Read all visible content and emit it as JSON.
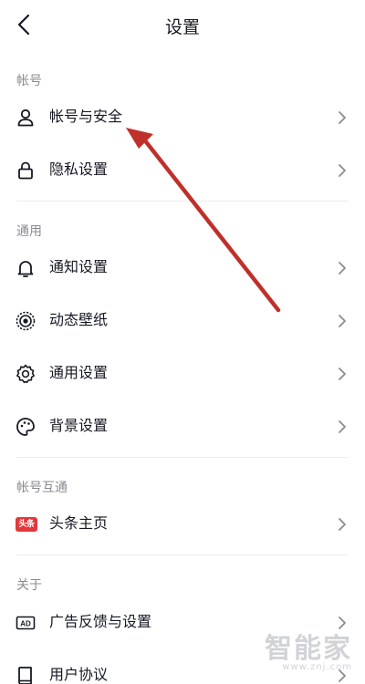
{
  "header": {
    "title": "设置"
  },
  "sections": {
    "account": {
      "label": "帐号"
    },
    "general": {
      "label": "通用"
    },
    "linked": {
      "label": "帐号互通"
    },
    "about": {
      "label": "关于"
    }
  },
  "items": {
    "account_security": "帐号与安全",
    "privacy": "隐私设置",
    "notification": "通知设置",
    "live_wallpaper": "动态壁纸",
    "general_settings": "通用设置",
    "background": "背景设置",
    "toutiao_home": "头条主页",
    "ad_feedback": "广告反馈与设置",
    "user_agreement": "用户协议"
  },
  "badges": {
    "toutiao": "头条",
    "ad": "AD"
  },
  "icons": [
    "back-arrow-icon",
    "user-icon",
    "lock-icon",
    "bell-icon",
    "wallpaper-icon",
    "gear-icon",
    "palette-icon",
    "toutiao-icon",
    "ad-icon",
    "book-icon",
    "chevron-right-icon"
  ],
  "annotation": {
    "color": "#c0302b"
  },
  "watermark": {
    "text": "智能家",
    "url": "www.znj.com"
  }
}
